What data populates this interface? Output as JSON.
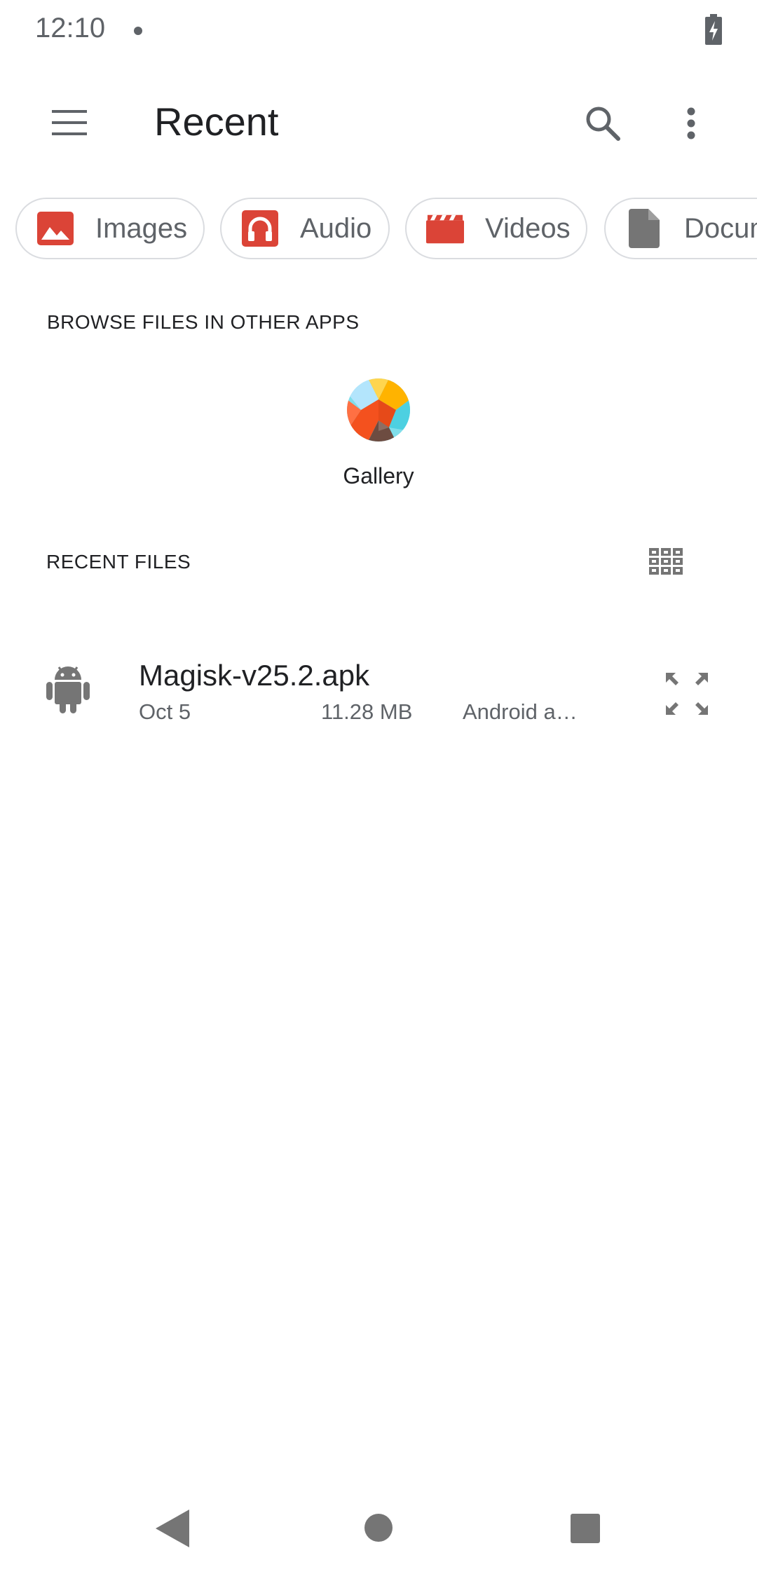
{
  "status_bar": {
    "time": "12:10"
  },
  "app_bar": {
    "title": "Recent"
  },
  "chips": [
    {
      "label": "Images",
      "icon": "image-icon"
    },
    {
      "label": "Audio",
      "icon": "headphones-icon"
    },
    {
      "label": "Videos",
      "icon": "clapperboard-icon"
    },
    {
      "label": "Docum",
      "icon": "document-icon"
    }
  ],
  "browse_section": {
    "heading": "BROWSE FILES IN OTHER APPS",
    "apps": [
      {
        "label": "Gallery",
        "icon": "gallery-app-icon"
      }
    ]
  },
  "recent_section": {
    "heading": "RECENT FILES"
  },
  "files": [
    {
      "name": "Magisk-v25.2.apk",
      "date": "Oct 5",
      "size": "11.28 MB",
      "type": "Android a…",
      "icon": "android-icon"
    }
  ],
  "colors": {
    "accent_red": "#db4437",
    "icon_gray": "#757575",
    "text_secondary": "#5f6368"
  }
}
